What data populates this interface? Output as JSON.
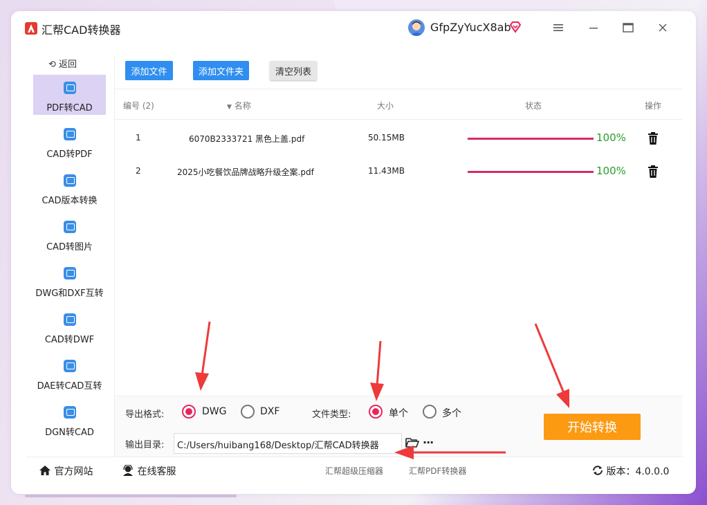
{
  "app": {
    "title": "汇帮CAD转换器",
    "username": "GfpZyYucX8ab"
  },
  "sidebar": {
    "back_label": "返回",
    "items": [
      {
        "label": "PDF转CAD",
        "active": true
      },
      {
        "label": "CAD转PDF"
      },
      {
        "label": "CAD版本转换"
      },
      {
        "label": "CAD转图片"
      },
      {
        "label": "DWG和DXF互转"
      },
      {
        "label": "CAD转DWF"
      },
      {
        "label": "DAE转CAD互转"
      },
      {
        "label": "DGN转CAD"
      }
    ]
  },
  "toolbar": {
    "add_file": "添加文件",
    "add_folder": "添加文件夹",
    "clear_list": "清空列表"
  },
  "table": {
    "headers": {
      "number": "编号 (2)",
      "name": "名称",
      "size": "大小",
      "status": "状态",
      "action": "操作"
    },
    "rows": [
      {
        "no": "1",
        "name": "6070B2333721 黑色上盖.pdf",
        "size": "50.15MB",
        "progress": "100%"
      },
      {
        "no": "2",
        "name": "2025小吃餐饮品牌战略升级全案.pdf",
        "size": "11.43MB",
        "progress": "100%"
      }
    ]
  },
  "options": {
    "export_format_label": "导出格式:",
    "formats": [
      "DWG",
      "DXF"
    ],
    "selected_format": "DWG",
    "file_type_label": "文件类型:",
    "file_types": [
      "单个",
      "多个"
    ],
    "selected_file_type": "单个",
    "output_dir_label": "输出目录:",
    "output_dir": "C:/Users/huibang168/Desktop/汇帮CAD转换器",
    "more": "···"
  },
  "start_button": "开始转换",
  "footer": {
    "official_site": "官方网站",
    "online_service": "在线客服",
    "link1": "汇帮超级压缩器",
    "link2": "汇帮PDF转换器",
    "version": "版本：4.0.0.0"
  },
  "colors": {
    "accent_blue": "#2f8ef0",
    "progress": "#d62a6a",
    "success": "#2a9d2a",
    "radio": "#e8255b",
    "start": "#fc9a12",
    "annotation_arrow": "#ee3a3a"
  }
}
